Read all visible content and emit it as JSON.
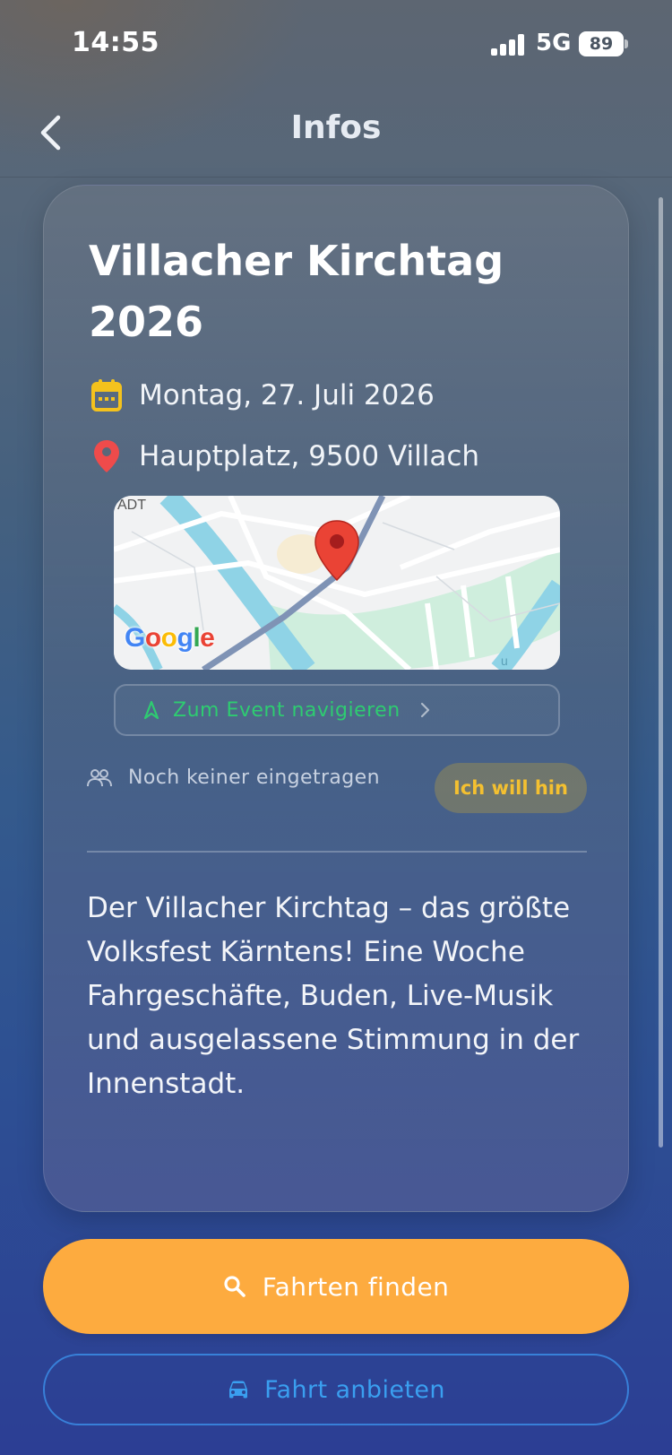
{
  "status_bar": {
    "time": "14:55",
    "network": "5G",
    "battery": "89"
  },
  "header": {
    "title": "Infos",
    "back_icon": "chevron-left-icon"
  },
  "event": {
    "title": "Villacher Kirchtag 2026",
    "date": "Montag, 27. Juli 2026",
    "location": "Hauptplatz, 9500 Villach",
    "map": {
      "provider_logo": "Google",
      "district_label": "ADT",
      "street_label": "u"
    },
    "navigate_label": "Zum Event navigieren",
    "attendees_label": "Noch keiner eingetragen",
    "want_to_go_label": "Ich will hin",
    "description": "Der Villacher Kirchtag – das größte Volksfest Kärntens! Eine Woche Fahrgeschäfte, Buden, Live-Musik und ausgelassene Stimmung in der Innenstadt."
  },
  "actions": {
    "find_rides_label": "Fahrten finden",
    "offer_ride_label": "Fahrt anbieten"
  },
  "colors": {
    "accent_orange": "#fdab3f",
    "accent_blue": "#3a9ff0",
    "success_green": "#2ecc71",
    "calendar_yellow": "#f4c21d",
    "pin_red": "#ea4335"
  }
}
